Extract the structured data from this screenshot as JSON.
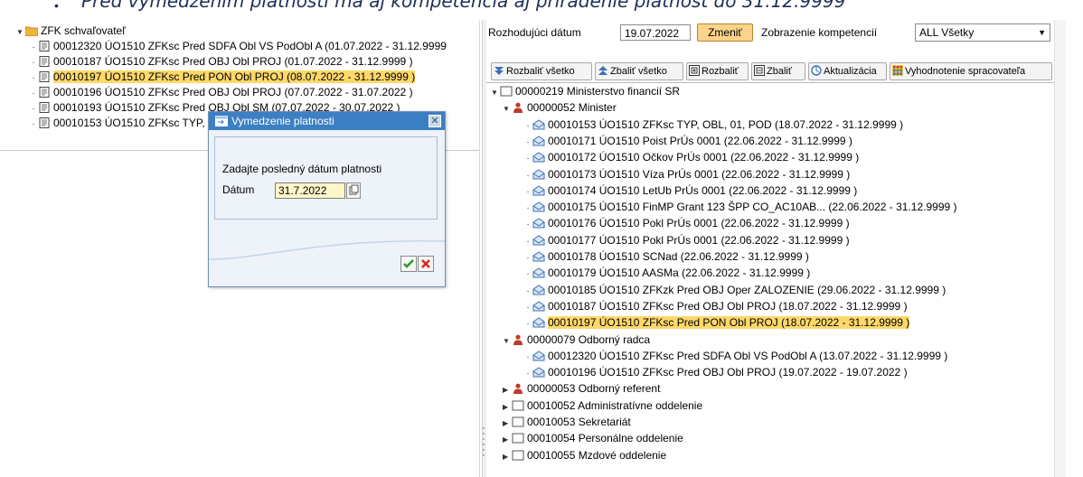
{
  "caption": {
    "text": "Pred vymedzením platnosti má aj kompetencia aj priradenie platnosť do 31.12.9999"
  },
  "left_tree": {
    "root": {
      "label": "ZFK schvaľovateľ"
    },
    "items": [
      {
        "text": "00012320 ÚO1510 ZFKsc  Pred SDFA Obl VS PodObl A (01.07.2022 - 31.12.9999"
      },
      {
        "text": "00010187 ÚO1510 ZFKsc  Pred OBJ Obl PROJ (01.07.2022 - 31.12.9999 )"
      },
      {
        "text": "00010197 ÚO1510 ZFKsc  Pred PON Obl PROJ (08.07.2022 - 31.12.9999 )",
        "selected": true
      },
      {
        "text": "00010196 ÚO1510 ZFKsc  Pred OBJ Obl PROJ (07.07.2022 - 31.07.2022 )"
      },
      {
        "text": "00010193 ÚO1510 ZFKsc  Pred OBJ Obl SM (07.07.2022 - 30.07.2022 )"
      },
      {
        "text": "00010153 ÚO1510 ZFKsc  TYP, OBL, 01, POD (01.07.2022 - 31.12.9999 )"
      }
    ]
  },
  "header": {
    "date_label": "Rozhodujúci dátum",
    "date_value": "19.07.2022",
    "change_button": "Zmeniť",
    "comp_label": "Zobrazenie kompetencií",
    "comp_value": "ALL Všetky"
  },
  "toolbar": {
    "expand_all": "Rozbaliť všetko",
    "collapse_all": "Zbaliť všetko",
    "expand": "Rozbaliť",
    "collapse": "Zbaliť",
    "refresh": "Aktualizácia",
    "evaluation": "Vyhodnotenie spracovateľa"
  },
  "right_tree": {
    "rows": [
      {
        "level": 0,
        "kind": "org",
        "expander": "open",
        "text": "00000219 Ministerstvo financií SR"
      },
      {
        "level": 1,
        "kind": "person",
        "expander": "open",
        "text": "00000052 Minister"
      },
      {
        "level": 2,
        "kind": "comp",
        "expander": "dot",
        "text": "00010153 ÚO1510 ZFKsc  TYP, OBL, 01, POD (18.07.2022 - 31.12.9999 )"
      },
      {
        "level": 2,
        "kind": "comp",
        "expander": "dot",
        "text": "00010171 ÚO1510 Poist  PrÚs 0001 (22.06.2022 - 31.12.9999 )"
      },
      {
        "level": 2,
        "kind": "comp",
        "expander": "dot",
        "text": "00010172 ÚO1510 Očkov  PrÚs 0001 (22.06.2022 - 31.12.9999 )"
      },
      {
        "level": 2,
        "kind": "comp",
        "expander": "dot",
        "text": "00010173 ÚO1510 Víza  PrÚs 0001 (22.06.2022 - 31.12.9999 )"
      },
      {
        "level": 2,
        "kind": "comp",
        "expander": "dot",
        "text": "00010174 ÚO1510 LetUb  PrÚs 0001 (22.06.2022 - 31.12.9999 )"
      },
      {
        "level": 2,
        "kind": "comp",
        "expander": "dot",
        "text": "00010175 ÚO1510 FinMP  Grant 123 ŠPP CO_AC10AB... (22.06.2022 - 31.12.9999 )"
      },
      {
        "level": 2,
        "kind": "comp",
        "expander": "dot",
        "text": "00010176 ÚO1510 Pokl  PrÚs 0001 (22.06.2022 - 31.12.9999 )"
      },
      {
        "level": 2,
        "kind": "comp",
        "expander": "dot",
        "text": "00010177 ÚO1510 Pokl  PrÚs 0001 (22.06.2022 - 31.12.9999 )"
      },
      {
        "level": 2,
        "kind": "comp",
        "expander": "dot",
        "text": "00010178 ÚO1510 SCNad (22.06.2022 - 31.12.9999 )"
      },
      {
        "level": 2,
        "kind": "comp",
        "expander": "dot",
        "text": "00010179 ÚO1510 AASMa (22.06.2022 - 31.12.9999 )"
      },
      {
        "level": 2,
        "kind": "comp",
        "expander": "dot",
        "text": "00010185 ÚO1510 ZFKzk  Pred OBJ Oper ZALOZENIE (29.06.2022 - 31.12.9999 )"
      },
      {
        "level": 2,
        "kind": "comp",
        "expander": "dot",
        "text": "00010187 ÚO1510 ZFKsc  Pred OBJ Obl PROJ (18.07.2022 - 31.12.9999 )"
      },
      {
        "level": 2,
        "kind": "comp",
        "expander": "dot",
        "text": "00010197 ÚO1510 ZFKsc  Pred PON Obl PROJ (18.07.2022 - 31.12.9999 )",
        "selected": true
      },
      {
        "level": 1,
        "kind": "person",
        "expander": "open",
        "text": "00000079 Odborný radca"
      },
      {
        "level": 2,
        "kind": "comp",
        "expander": "dot",
        "text": "00012320 ÚO1510 ZFKsc  Pred SDFA Obl VS PodObl A (13.07.2022 - 31.12.9999 )"
      },
      {
        "level": 2,
        "kind": "comp",
        "expander": "dot",
        "text": "00010196 ÚO1510 ZFKsc  Pred OBJ Obl PROJ (19.07.2022 - 19.07.2022 )"
      },
      {
        "level": 1,
        "kind": "person",
        "expander": "closed",
        "text": "00000053 Odborný referent"
      },
      {
        "level": 1,
        "kind": "org",
        "expander": "closed",
        "text": "00010052 Administratívne oddelenie"
      },
      {
        "level": 1,
        "kind": "org",
        "expander": "closed",
        "text": "00010053 Sekretariát"
      },
      {
        "level": 1,
        "kind": "org",
        "expander": "closed",
        "text": "00010054 Personálne oddelenie"
      },
      {
        "level": 1,
        "kind": "org",
        "expander": "closed",
        "text": "00010055 Mzdové oddelenie"
      }
    ]
  },
  "popup": {
    "title": "Vymedzenie platnosti",
    "prompt": "Zadajte posledný dátum platnosti",
    "date_label": "Dátum",
    "date_value": "31.7.2022"
  },
  "colors": {
    "selection": "#ffd86a",
    "popup_title": "#3d7fc3",
    "change_button": "#fbd38a"
  }
}
